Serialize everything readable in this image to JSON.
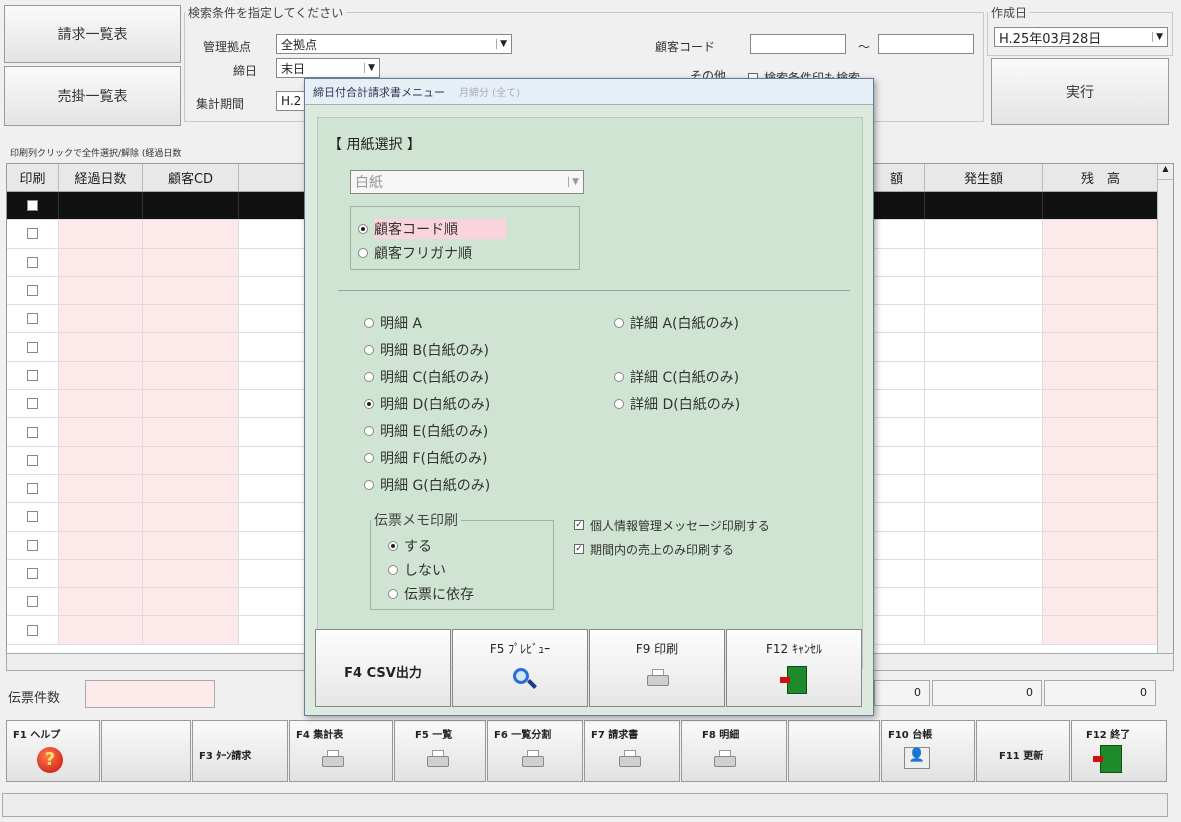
{
  "left_buttons": {
    "invoice_list": "請求一覧表",
    "receivable_list": "売掛一覧表"
  },
  "search": {
    "legend": "検索条件を指定してください",
    "branch_label": "管理拠点",
    "branch_value": "全拠点",
    "closing_label": "締日",
    "closing_value": "末日",
    "period_label": "集計期間",
    "period_value": "H.2",
    "customer_code_label": "顧客コード",
    "tilde": "～",
    "other_label": "その他",
    "other_option": "検索条件印も検索"
  },
  "created": {
    "legend": "作成日",
    "date_value": "H.25年03月28日"
  },
  "run_button": "実行",
  "hint_text": "印刷列クリックで全件選択/解除 (経過日数",
  "grid": {
    "headers_left": [
      "印刷",
      "経過日数",
      "顧客CD"
    ],
    "headers_right": [
      "額",
      "発生額",
      "残　高"
    ],
    "row_count": 16
  },
  "footer_left": {
    "label": "伝票件数",
    "totals": [
      "0",
      "0",
      "0"
    ]
  },
  "modal": {
    "title": "締日付合計請求書メニュー",
    "title_ghost": "月締分 (全て)",
    "paper_section": "【 用紙選択 】",
    "paper_value": "白紙",
    "sort_options": [
      "顧客コード順",
      "顧客フリガナ順"
    ],
    "format_left": [
      "明細 A",
      "明細 B(白紙のみ)",
      "明細 C(白紙のみ)",
      "明細 D(白紙のみ)",
      "明細 E(白紙のみ)",
      "明細 F(白紙のみ)",
      "明細 G(白紙のみ)"
    ],
    "format_right": [
      "詳細 A(白紙のみ)",
      "詳細 C(白紙のみ)",
      "詳細 D(白紙のみ)"
    ],
    "memo_legend": "伝票メモ印刷",
    "memo_options": [
      "する",
      "しない",
      "伝票に依存"
    ],
    "check_privacy": "個人情報管理メッセージ印刷する",
    "check_period": "期間内の売上のみ印刷する",
    "buttons": {
      "csv": "F4 CSV出力",
      "preview": "F5 ﾌﾟﾚﾋﾞｭｰ",
      "print": "F9 印刷",
      "cancel": "F12 ｷｬﾝｾﾙ"
    }
  },
  "fkeys": {
    "f1": "F1 ヘルプ",
    "f3": "F3 ﾀｰﾝ請求",
    "f4": "F4 集計表",
    "f5": "F5 一覧",
    "f6": "F6 一覧分割",
    "f7": "F7 請求書",
    "f8": "F8 明細",
    "f10": "F10 台帳",
    "f11": "F11 更新",
    "f12": "F12 終了"
  },
  "colors": {
    "pink_cell": "#fde8ea",
    "modal_bg": "#cfe4d3",
    "selected_row": "#111111"
  }
}
